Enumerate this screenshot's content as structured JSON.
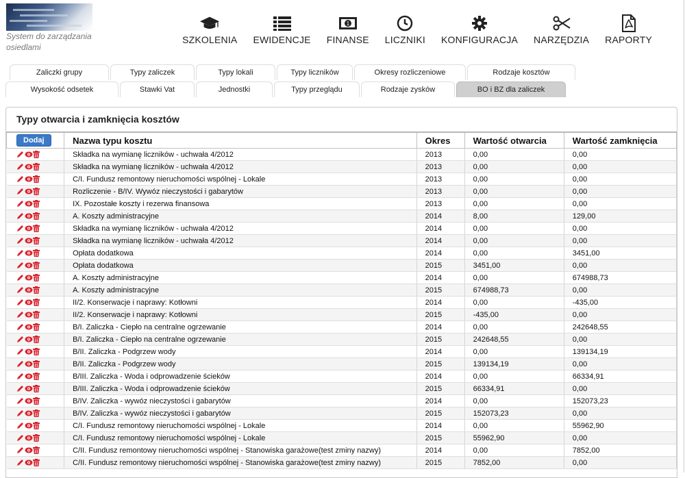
{
  "app": {
    "subtitle": "System do zarządzania osiedlami"
  },
  "nav": [
    {
      "label": "SZKOLENIA",
      "icon": "graduation-cap-icon"
    },
    {
      "label": "EWIDENCJE",
      "icon": "list-icon"
    },
    {
      "label": "FINANSE",
      "icon": "money-icon"
    },
    {
      "label": "LICZNIKI",
      "icon": "clock-icon"
    },
    {
      "label": "KONFIGURACJA",
      "icon": "gear-icon"
    },
    {
      "label": "NARZĘDZIA",
      "icon": "scissors-icon"
    },
    {
      "label": "RAPORTY",
      "icon": "pdf-icon"
    }
  ],
  "tabs_row1": [
    "Zaliczki grupy",
    "Typy zaliczek",
    "Typy lokali",
    "Typy liczników",
    "Okresy rozliczeniowe",
    "Rodzaje kosztów"
  ],
  "tabs_row2": [
    "Wysokość odsetek",
    "Stawki Vat",
    "Jednostki",
    "Typy przeglądu",
    "Rodzaje zysków",
    "BO i BZ dla zaliczek"
  ],
  "active_tab": "BO i BZ dla zaliczek",
  "panel": {
    "title": "Typy otwarcia i zamknięcia kosztów",
    "add_button": "Dodaj",
    "columns": [
      "Nazwa typu kosztu",
      "Okres",
      "Wartość otwarcia",
      "Wartość zamknięcia"
    ],
    "rows": [
      [
        "Składka na wymianę liczników - uchwała 4/2012",
        "2013",
        "0,00",
        "0,00"
      ],
      [
        "Składka na wymianę liczników - uchwała 4/2012",
        "2013",
        "0,00",
        "0,00"
      ],
      [
        "C/I. Fundusz remontowy nieruchomości wspólnej - Lokale",
        "2013",
        "0,00",
        "0,00"
      ],
      [
        "Rozliczenie - B/IV. Wywóz nieczystości i gabarytów",
        "2013",
        "0,00",
        "0,00"
      ],
      [
        "IX. Pozostałe koszty i rezerwa finansowa",
        "2013",
        "0,00",
        "0,00"
      ],
      [
        "A. Koszty administracyjne",
        "2014",
        "8,00",
        "129,00"
      ],
      [
        "Składka na wymianę liczników - uchwała 4/2012",
        "2014",
        "0,00",
        "0,00"
      ],
      [
        "Składka na wymianę liczników - uchwała 4/2012",
        "2014",
        "0,00",
        "0,00"
      ],
      [
        "Opłata dodatkowa",
        "2014",
        "0,00",
        "3451,00"
      ],
      [
        "Opłata dodatkowa",
        "2015",
        "3451,00",
        "0,00"
      ],
      [
        "A. Koszty administracyjne",
        "2014",
        "0,00",
        "674988,73"
      ],
      [
        "A. Koszty administracyjne",
        "2015",
        "674988,73",
        "0,00"
      ],
      [
        "II/2. Konserwacje i naprawy: Kotłowni",
        "2014",
        "0,00",
        "-435,00"
      ],
      [
        "II/2. Konserwacje i naprawy: Kotłowni",
        "2015",
        "-435,00",
        "0,00"
      ],
      [
        "B/I. Zaliczka - Ciepło na centralne ogrzewanie",
        "2014",
        "0,00",
        "242648,55"
      ],
      [
        "B/I. Zaliczka - Ciepło na centralne ogrzewanie",
        "2015",
        "242648,55",
        "0,00"
      ],
      [
        "B/II. Zaliczka - Podgrzew wody",
        "2014",
        "0,00",
        "139134,19"
      ],
      [
        "B/II. Zaliczka - Podgrzew wody",
        "2015",
        "139134,19",
        "0,00"
      ],
      [
        "B/III. Zaliczka - Woda i odprowadzenie ścieków",
        "2014",
        "0,00",
        "66334,91"
      ],
      [
        "B/III. Zaliczka - Woda i odprowadzenie ścieków",
        "2015",
        "66334,91",
        "0,00"
      ],
      [
        "B/IV. Zaliczka - wywóz nieczystości i gabarytów",
        "2014",
        "0,00",
        "152073,23"
      ],
      [
        "B/IV. Zaliczka - wywóz nieczystości i gabarytów",
        "2015",
        "152073,23",
        "0,00"
      ],
      [
        "C/I. Fundusz remontowy nieruchomości wspólnej - Lokale",
        "2014",
        "0,00",
        "55962,90"
      ],
      [
        "C/I. Fundusz remontowy nieruchomości wspólnej - Lokale",
        "2015",
        "55962,90",
        "0,00"
      ],
      [
        "C/II. Fundusz remontowy nieruchomości wspólnej - Stanowiska garażowe(test zminy nazwy)",
        "2014",
        "0,00",
        "7852,00"
      ],
      [
        "C/II. Fundusz remontowy nieruchomości wspólnej - Stanowiska garażowe(test zminy nazwy)",
        "2015",
        "7852,00",
        "0,00"
      ]
    ]
  },
  "colors": {
    "accent": "#3a7ac8",
    "action_icons": "#d9232d",
    "active_tab": "#cfcfcf"
  }
}
